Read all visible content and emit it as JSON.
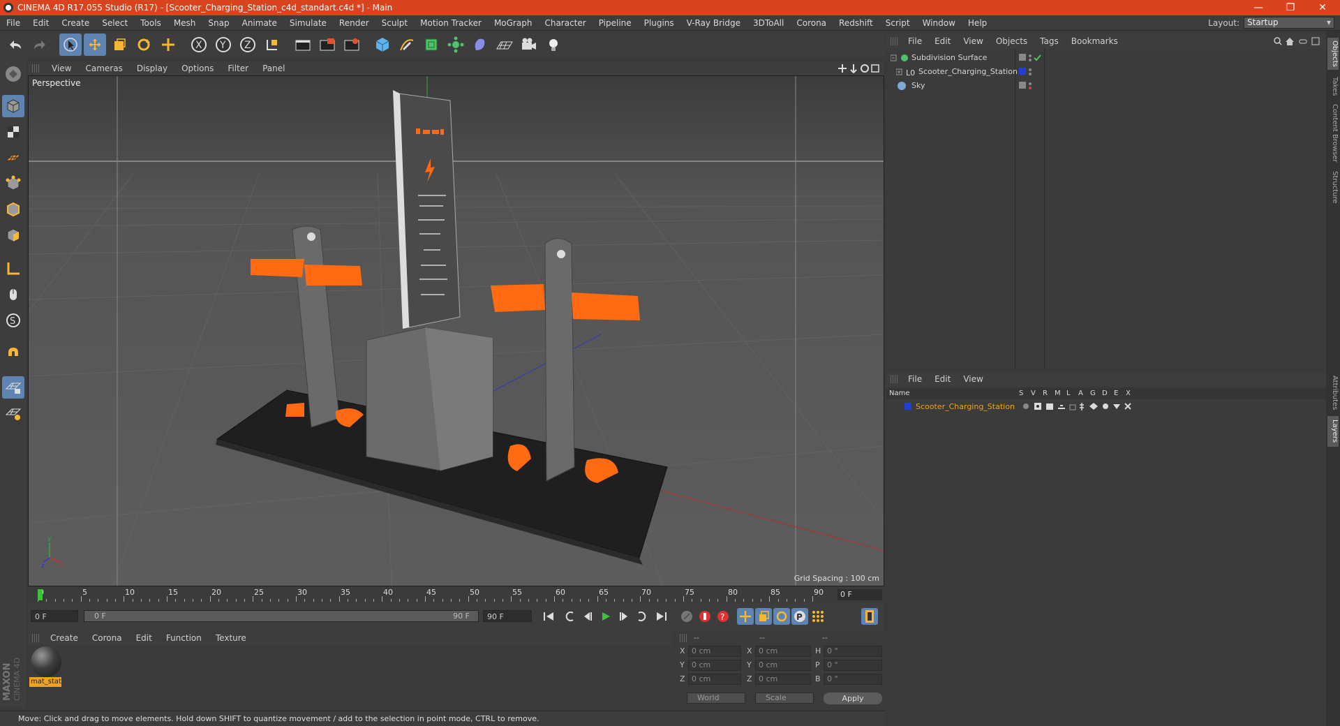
{
  "window": {
    "title": "CINEMA 4D R17.055 Studio (R17) - [Scooter_Charging_Station_c4d_standart.c4d *] - Main",
    "controls": [
      "—",
      "❐",
      "✕"
    ]
  },
  "menu": [
    "File",
    "Edit",
    "Create",
    "Select",
    "Tools",
    "Mesh",
    "Snap",
    "Animate",
    "Simulate",
    "Render",
    "Sculpt",
    "Motion Tracker",
    "MoGraph",
    "Character",
    "Pipeline",
    "Plugins",
    "V-Ray Bridge",
    "3DToAll",
    "Corona",
    "Redshift",
    "Script",
    "Window",
    "Help"
  ],
  "layout": {
    "label": "Layout:",
    "value": "Startup"
  },
  "viewport": {
    "menu": [
      "View",
      "Cameras",
      "Display",
      "Options",
      "Filter",
      "Panel"
    ],
    "label": "Perspective",
    "grid_spacing": "Grid Spacing : 100 cm"
  },
  "timeline": {
    "ticks": [
      "0",
      "5",
      "10",
      "15",
      "20",
      "25",
      "30",
      "35",
      "40",
      "45",
      "50",
      "55",
      "60",
      "65",
      "70",
      "75",
      "80",
      "85",
      "90"
    ],
    "current_frame": "0 F",
    "start": "0 F",
    "range_start": "0 F",
    "range_end": "90 F",
    "end": "90 F"
  },
  "materials": {
    "menu": [
      "Create",
      "Corona",
      "Edit",
      "Function",
      "Texture"
    ],
    "items": [
      {
        "name": "mat_stat"
      }
    ]
  },
  "coordinates": {
    "header": [
      "--",
      "--",
      "--"
    ],
    "pos": [
      {
        "axis": "X",
        "value": "0 cm"
      },
      {
        "axis": "Y",
        "value": "0 cm"
      },
      {
        "axis": "Z",
        "value": "0 cm"
      }
    ],
    "size": [
      {
        "axis": "X",
        "value": "0 cm"
      },
      {
        "axis": "Y",
        "value": "0 cm"
      },
      {
        "axis": "Z",
        "value": "0 cm"
      }
    ],
    "rot": [
      {
        "axis": "H",
        "value": "0 °"
      },
      {
        "axis": "P",
        "value": "0 °"
      },
      {
        "axis": "B",
        "value": "0 °"
      }
    ],
    "space": "World",
    "mode": "Scale",
    "apply": "Apply"
  },
  "status": "Move: Click and drag to move elements. Hold down SHIFT to quantize movement / add to the selection in point mode, CTRL to remove.",
  "objects": {
    "menu": [
      "File",
      "Edit",
      "View",
      "Objects",
      "Tags",
      "Bookmarks"
    ],
    "items": [
      {
        "name": "Subdivision Surface"
      },
      {
        "name": "Scooter_Charging_Station"
      },
      {
        "name": "Sky"
      }
    ]
  },
  "layers": {
    "menu": [
      "File",
      "Edit",
      "View"
    ],
    "columns": [
      "Name",
      "S",
      "V",
      "R",
      "M",
      "L",
      "A",
      "G",
      "D",
      "E",
      "X"
    ],
    "items": [
      {
        "name": "Scooter_Charging_Station",
        "color": "#1f3fd6"
      }
    ]
  },
  "right_tabs": [
    "Objects",
    "Takes",
    "Content Browser",
    "Structure",
    "Attributes",
    "Layers"
  ],
  "colors": {
    "accent": "#d9441e",
    "selection": "#f0a31e",
    "highlight": "#5e84b2",
    "model_orange": "#ff6a13"
  }
}
